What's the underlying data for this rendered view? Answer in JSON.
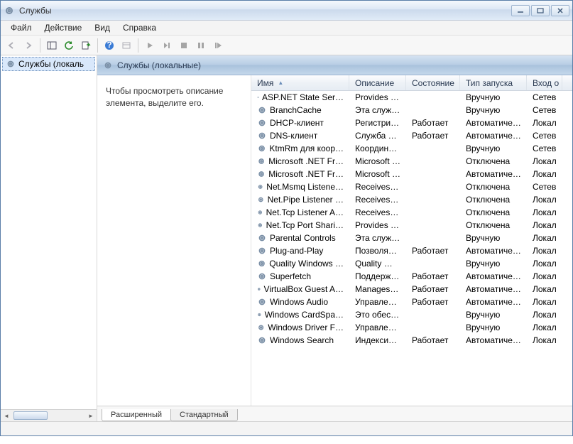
{
  "window": {
    "title": "Службы"
  },
  "menu": {
    "file": "Файл",
    "action": "Действие",
    "view": "Вид",
    "help": "Справка"
  },
  "nav": {
    "item0": "Службы (локаль"
  },
  "header": {
    "title": "Службы (локальные)"
  },
  "description": {
    "line": "Чтобы просмотреть описание элемента, выделите его."
  },
  "columns": {
    "name": "Имя",
    "desc": "Описание",
    "state": "Состояние",
    "start": "Тип запуска",
    "logon": "Вход о"
  },
  "tabs": {
    "ext": "Расширенный",
    "std": "Стандартный"
  },
  "winbtns": {
    "min": "_",
    "max": "▢",
    "close": "✕"
  },
  "rows": [
    {
      "name": "ASP.NET State Ser…",
      "desc": "Provides s…",
      "state": "",
      "start": "Вручную",
      "logon": "Сетев"
    },
    {
      "name": "BranchCache",
      "desc": "Эта служб…",
      "state": "",
      "start": "Вручную",
      "logon": "Сетев"
    },
    {
      "name": "DHCP-клиент",
      "desc": "Регистрир…",
      "state": "Работает",
      "start": "Автоматиче…",
      "logon": "Локал"
    },
    {
      "name": "DNS-клиент",
      "desc": "Служба D…",
      "state": "Работает",
      "start": "Автоматиче…",
      "logon": "Сетев"
    },
    {
      "name": "KtmRm для коор…",
      "desc": "Координи…",
      "state": "",
      "start": "Вручную",
      "logon": "Сетев"
    },
    {
      "name": "Microsoft .NET Fr…",
      "desc": "Microsoft …",
      "state": "",
      "start": "Отключена",
      "logon": "Локал"
    },
    {
      "name": "Microsoft .NET Fr…",
      "desc": "Microsoft …",
      "state": "",
      "start": "Автоматиче…",
      "logon": "Локал"
    },
    {
      "name": "Net.Msmq Listene…",
      "desc": "Receives a…",
      "state": "",
      "start": "Отключена",
      "logon": "Сетев"
    },
    {
      "name": "Net.Pipe Listener …",
      "desc": "Receives a…",
      "state": "",
      "start": "Отключена",
      "logon": "Локал"
    },
    {
      "name": "Net.Tcp Listener A…",
      "desc": "Receives a…",
      "state": "",
      "start": "Отключена",
      "logon": "Локал"
    },
    {
      "name": "Net.Tcp Port Shari…",
      "desc": "Provides a…",
      "state": "",
      "start": "Отключена",
      "logon": "Локал"
    },
    {
      "name": "Parental Controls",
      "desc": "Эта служб…",
      "state": "",
      "start": "Вручную",
      "logon": "Локал"
    },
    {
      "name": "Plug-and-Play",
      "desc": "Позволяет…",
      "state": "Работает",
      "start": "Автоматиче…",
      "logon": "Локал"
    },
    {
      "name": "Quality Windows …",
      "desc": "Quality Wi…",
      "state": "",
      "start": "Вручную",
      "logon": "Локал"
    },
    {
      "name": "Superfetch",
      "desc": "Поддержи…",
      "state": "Работает",
      "start": "Автоматиче…",
      "logon": "Локал"
    },
    {
      "name": "VirtualBox Guest A…",
      "desc": "Manages V…",
      "state": "Работает",
      "start": "Автоматиче…",
      "logon": "Локал"
    },
    {
      "name": "Windows Audio",
      "desc": "Управлен…",
      "state": "Работает",
      "start": "Автоматиче…",
      "logon": "Локал"
    },
    {
      "name": "Windows CardSpa…",
      "desc": "Это обесп…",
      "state": "",
      "start": "Вручную",
      "logon": "Локал"
    },
    {
      "name": "Windows Driver F…",
      "desc": "Управлен…",
      "state": "",
      "start": "Вручную",
      "logon": "Локал"
    },
    {
      "name": "Windows Search",
      "desc": "Индексир…",
      "state": "Работает",
      "start": "Автоматиче…",
      "logon": "Локал"
    }
  ]
}
